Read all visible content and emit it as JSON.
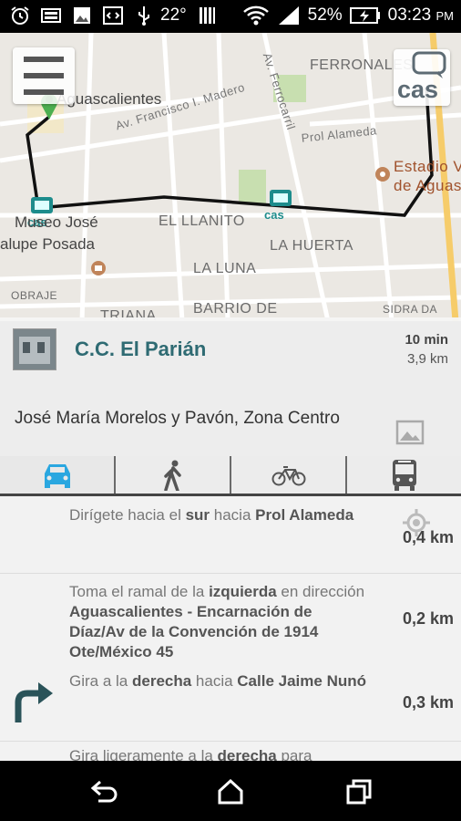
{
  "status_bar": {
    "temperature": "22°",
    "battery_percent": "52%",
    "time": "03:23",
    "ampm": "PM",
    "icons": [
      "alarm-clock-icon",
      "keyboard-icon",
      "image-icon",
      "code-icon",
      "usb-icon",
      "signal-bars-icon",
      "wifi-icon",
      "cellular-icon",
      "battery-charging-icon"
    ]
  },
  "map": {
    "labels": {
      "aguascalientes": "Aguascalientes",
      "ferronales": "FERRONALES",
      "av_madero": "Av. Francisco I. Madero",
      "av_ferrocarril": "Av. Ferrocarril",
      "prol_alameda": "Prol Alameda",
      "estadio_1": "Estadio V",
      "estadio_2": "de Aguas",
      "museo_1": "Museo José",
      "museo_2": "alupe Posada",
      "el_llanito": "EL LLANITO",
      "la_huerta": "LA HUERTA",
      "la_luna": "LA LUNA",
      "obraje": "OBRAJE",
      "barrio_de": "BARRIO DE",
      "triana": "TRIANA",
      "sidrada": "SIDRA DA"
    },
    "route_color": "#111111",
    "start_pin_color": "#4caf50",
    "marker_label": "cas"
  },
  "logo": {
    "text": "cas"
  },
  "place": {
    "name": "C.C. El Parián",
    "eta_time": "10 min",
    "eta_distance": "3,9 km",
    "address": "José María Morelos y Pavón, Zona Centro"
  },
  "modes": [
    {
      "name": "car",
      "active": true
    },
    {
      "name": "walk",
      "active": false
    },
    {
      "name": "bike",
      "active": false
    },
    {
      "name": "bus",
      "active": false
    }
  ],
  "accent_color": "#2aa7e0",
  "steps": [
    {
      "text_pre": "Dirígete hacia el ",
      "text_bold1": "sur",
      "text_mid": " hacia ",
      "text_bold2": "Prol Alameda",
      "distance": "0,4 km"
    },
    {
      "text_pre": "Toma el ramal de la ",
      "text_bold1": "izquierda",
      "text_mid": " en dirección ",
      "text_bold2": "Aguascalientes - Encarnación de Díaz/Av de la Convención de 1914 Ote/México 45",
      "distance": "0,2 km"
    },
    {
      "text_pre": "Gira a la ",
      "text_bold1": "derecha",
      "text_mid": " hacia ",
      "text_bold2": "Calle Jaime Nunó",
      "distance": "0,3 km"
    },
    {
      "text_pre": "Gira ligeramente a la ",
      "text_bold1": "derecha",
      "text_mid": " para",
      "text_bold2": "",
      "distance": ""
    }
  ]
}
